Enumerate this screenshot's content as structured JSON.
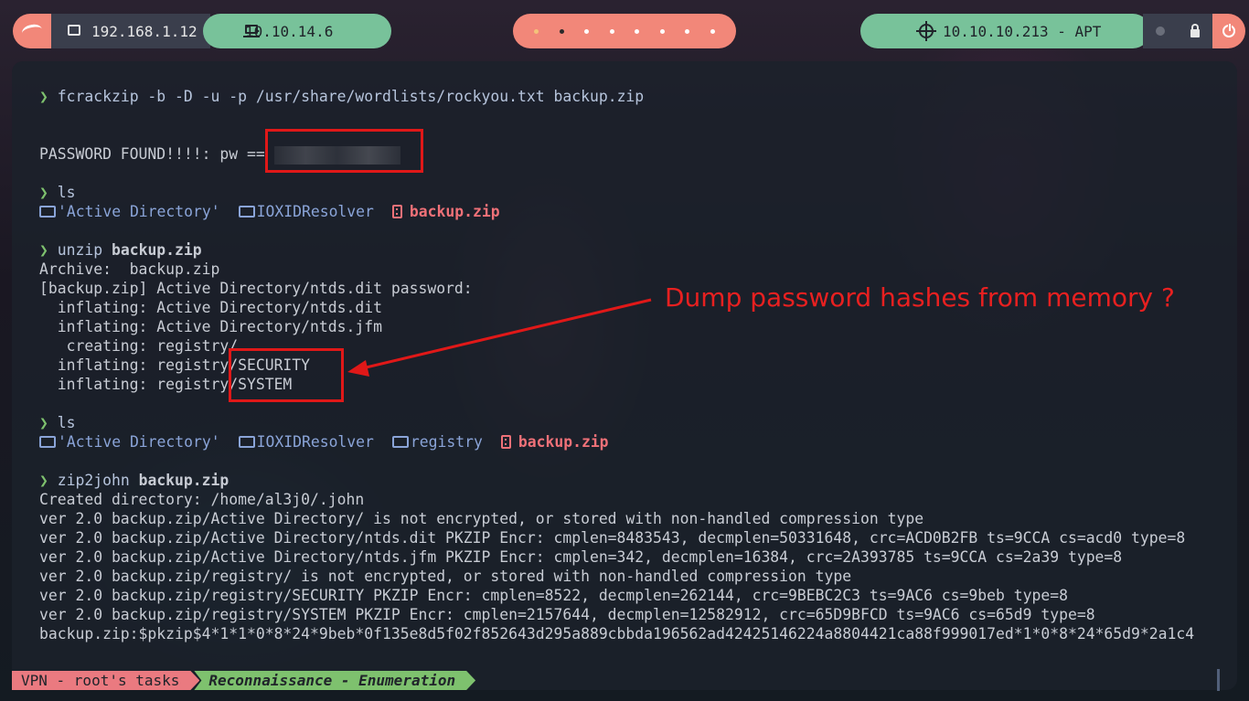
{
  "topbar": {
    "local_ip": "192.168.1.12",
    "vpn_ip": "10.10.14.6",
    "target": "10.10.10.213 - APT",
    "workspace_count": 8,
    "active_workspace": 2
  },
  "terminal": {
    "prompt_symbol": "❯",
    "cmd1": {
      "cmd": "fcrackzip",
      "args": " -b -D -u -p /usr/share/wordlists/rockyou.txt backup.zip"
    },
    "password_found": "PASSWORD FOUND!!!!: pw == ",
    "cmd2": {
      "cmd": "ls"
    },
    "ls1": {
      "dir1": "'Active Directory'",
      "dir2": "IOXIDResolver",
      "zip": "backup.zip"
    },
    "cmd3": {
      "cmd": "unzip",
      "arg": "backup.zip"
    },
    "unzip_output": [
      "Archive:  backup.zip",
      "[backup.zip] Active Directory/ntds.dit password:",
      "  inflating: Active Directory/ntds.dit",
      "  inflating: Active Directory/ntds.jfm",
      "   creating: registry/",
      "  inflating: registry/SECURITY",
      "  inflating: registry/SYSTEM"
    ],
    "cmd4": {
      "cmd": "ls"
    },
    "ls2": {
      "dir1": "'Active Directory'",
      "dir2": "IOXIDResolver",
      "dir3": "registry",
      "zip": "backup.zip"
    },
    "cmd5": {
      "cmd": "zip2john",
      "arg": "backup.zip"
    },
    "zip2john_output": [
      "Created directory: /home/al3j0/.john",
      "ver 2.0 backup.zip/Active Directory/ is not encrypted, or stored with non-handled compression type",
      "ver 2.0 backup.zip/Active Directory/ntds.dit PKZIP Encr: cmplen=8483543, decmplen=50331648, crc=ACD0B2FB ts=9CCA cs=acd0 type=8",
      "ver 2.0 backup.zip/Active Directory/ntds.jfm PKZIP Encr: cmplen=342, decmplen=16384, crc=2A393785 ts=9CCA cs=2a39 type=8",
      "ver 2.0 backup.zip/registry/ is not encrypted, or stored with non-handled compression type",
      "ver 2.0 backup.zip/registry/SECURITY PKZIP Encr: cmplen=8522, decmplen=262144, crc=9BEBC2C3 ts=9AC6 cs=9beb type=8",
      "ver 2.0 backup.zip/registry/SYSTEM PKZIP Encr: cmplen=2157644, decmplen=12582912, crc=65D9BFCD ts=9AC6 cs=65d9 type=8",
      "backup.zip:$pkzip$4*1*1*0*8*24*9beb*0f135e8d5f02f852643d295a889cbbda196562ad42425146224a8804421ca88f999017ed*1*0*8*24*65d9*2a1c4"
    ]
  },
  "annotation": {
    "text": "Dump password hashes from memory ?"
  },
  "statusbar": {
    "session": "VPN - root's tasks",
    "window": "Reconnaissance - Enumeration"
  }
}
